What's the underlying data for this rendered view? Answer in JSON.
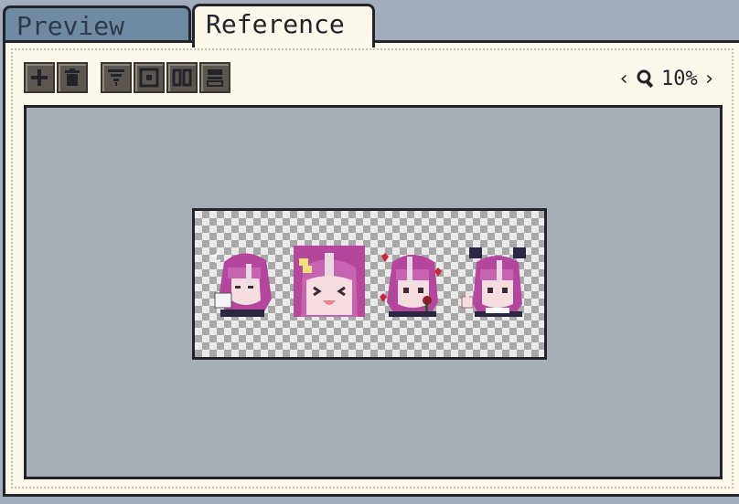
{
  "tabs": [
    {
      "label": "Preview",
      "active": false
    },
    {
      "label": "Reference",
      "active": true
    }
  ],
  "toolbar": {
    "group1": [
      "add-icon",
      "trash-icon"
    ],
    "group2": [
      "fit-icon",
      "frame-icon",
      "split-icon",
      "layout-icon"
    ]
  },
  "zoom": {
    "value": "10%",
    "prev": "‹",
    "next": "›"
  },
  "sprites": [
    "character-sprite-shy",
    "character-sprite-laughing",
    "character-sprite-hearts",
    "character-sprite-thumbs-up"
  ],
  "colors": {
    "background": "#a3acbb",
    "panel": "#fdf8ec",
    "canvas": "#a6afb5",
    "inactive_tab": "#6f8aa1",
    "hair": "#b4479b",
    "accent": "#22242a"
  }
}
